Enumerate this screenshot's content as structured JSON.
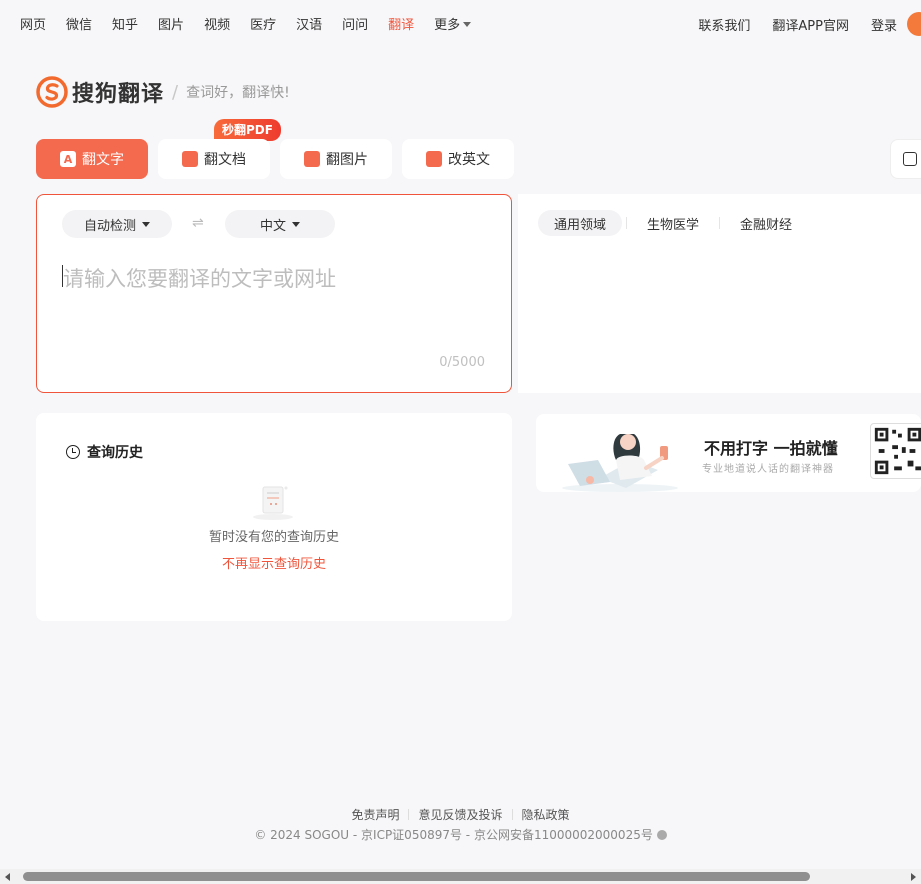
{
  "topnav": {
    "left": [
      "网页",
      "微信",
      "知乎",
      "图片",
      "视频",
      "医疗",
      "汉语",
      "问问",
      "翻译",
      "更多"
    ],
    "active_index": 8,
    "right": [
      "联系我们",
      "翻译APP官网",
      "登录"
    ]
  },
  "logo": {
    "name": "搜狗翻译",
    "slogan": "查词好，翻译快!"
  },
  "tabs": [
    {
      "label": "翻文字",
      "icon": "A"
    },
    {
      "label": "翻文档",
      "icon": ""
    },
    {
      "label": "翻图片",
      "icon": ""
    },
    {
      "label": "改英文",
      "icon": ""
    }
  ],
  "pdf_badge": "秒翻PDF",
  "input": {
    "source_lang": "自动检测",
    "target_lang": "中文",
    "swap_icon": "⇌",
    "placeholder": "请输入您要翻译的文字或网址",
    "counter": "0/5000"
  },
  "domains": [
    "通用领域",
    "生物医学",
    "金融财经"
  ],
  "history": {
    "title": "查询历史",
    "empty_text": "暂时没有您的查询历史",
    "hide_link": "不再显示查询历史"
  },
  "banner": {
    "headline": "不用打字  一拍就懂",
    "sub": "专业地道说人话的翻译神器"
  },
  "footer": {
    "links": [
      "免责声明",
      "意见反馈及投诉",
      "隐私政策"
    ],
    "copyright": "© 2024 SOGOU - 京ICP证050897号 - 京公网安备11000002000025号"
  },
  "colors": {
    "accent": "#f0553b",
    "tab_active": "#f46a4f"
  }
}
